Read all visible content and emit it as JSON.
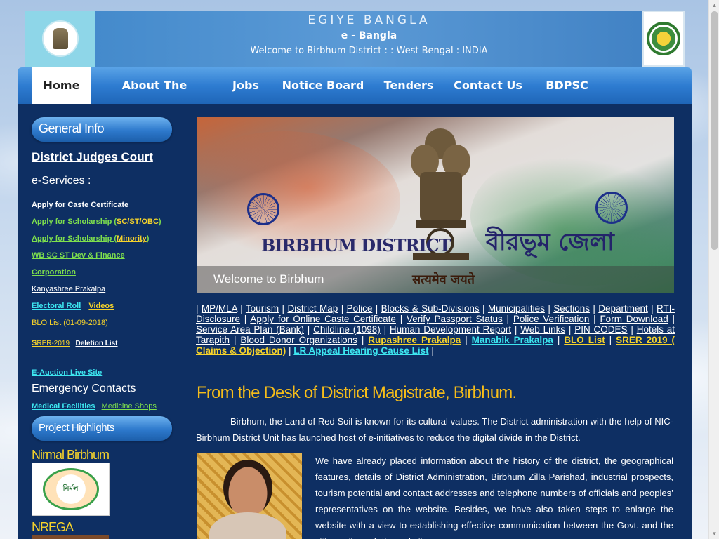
{
  "header": {
    "title": "EGIYE BANGLA",
    "subtitle": "e - Bangla",
    "welcome": "Welcome to Birbhum District : : West Bengal : INDIA"
  },
  "nav": [
    "Home",
    "About The District",
    "Jobs",
    "Notice Board",
    "Tenders",
    "Contact Us",
    "BDPSC"
  ],
  "sidebar": {
    "general_info": "General Info",
    "district_judges": "District Judges Court",
    "eservices": "e-Services :",
    "caste_cert": "Apply for Caste Certificate",
    "scholarship_sc_pre": "Apply for Scholarship (",
    "scholarship_sc_val": "SC/ST/OBC",
    "scholarship_sc_post": ")",
    "scholarship_min_pre": "Apply for Scholarship (",
    "scholarship_min_val": "Minority",
    "scholarship_min_post": ")",
    "wbsc_line1": "WB SC ST Dev & Finance",
    "wbsc_line2": "Corporation",
    "kanyashree": "Kanyashree Prakalpa",
    "electoral": "Electoral Roll",
    "videos": "Videos",
    "blo": "BLO List (01-09-2018)",
    "srer_s": "S",
    "srer_rest": "RER-2019",
    "deletion": "Deletion List",
    "eauction": "E-Auction Live Site",
    "emergency": "Emergency Contacts",
    "medical": "Medical Facilities",
    "medicine": "Medicine Shops",
    "project_highlights": "Project Highlights",
    "nirmal": "Nirmal Birbhum",
    "nirmal_logo_text": "নির্মল",
    "nrega": "NREGA"
  },
  "banner": {
    "title": "BIRBHUM DISTRICT",
    "bengali": "বীরভূম জেলা",
    "welcome": "Welcome to Birbhum",
    "motto": "सत्यमेव जयते"
  },
  "links": [
    {
      "t": "MP/MLA",
      "c": ""
    },
    {
      "t": "Tourism",
      "c": ""
    },
    {
      "t": "District Map",
      "c": ""
    },
    {
      "t": "Police",
      "c": ""
    },
    {
      "t": "Blocks & Sub-Divisions",
      "c": ""
    },
    {
      "t": "Municipalities",
      "c": ""
    },
    {
      "t": "Sections",
      "c": ""
    },
    {
      "t": "Department",
      "c": ""
    },
    {
      "t": "RTI-Disclosure",
      "c": ""
    },
    {
      "t": "Apply for Online Caste Certificate",
      "c": ""
    },
    {
      "t": "Verify Passport Status",
      "c": ""
    },
    {
      "t": "Police Verification",
      "c": ""
    },
    {
      "t": "Form Download",
      "c": ""
    },
    {
      "t": "Service Area Plan (Bank)",
      "c": ""
    },
    {
      "t": "Childline (1098)",
      "c": ""
    },
    {
      "t": "Human Development Report",
      "c": ""
    },
    {
      "t": "Web Links",
      "c": ""
    },
    {
      "t": "PIN CODES",
      "c": ""
    },
    {
      "t": "Hotels at Tarapith",
      "c": ""
    },
    {
      "t": "Blood Donor Organizations",
      "c": ""
    },
    {
      "t": "Rupashree Prakalpa",
      "c": "yl"
    },
    {
      "t": "Manabik Prakalpa",
      "c": "cy"
    },
    {
      "t": "BLO List",
      "c": "yl"
    },
    {
      "t": "SRER 2019 ( Claims & Objection)",
      "c": "yl"
    },
    {
      "t": "LR Appeal Hearing Cause List",
      "c": "cy"
    }
  ],
  "desk_heading": "From the Desk of District Magistrate, Birbhum.",
  "para1": "Birbhum, the Land of Red Soil is known for its cultural values. The District administration with the help of NIC-Birbhum District Unit has launched host of e-initiatives to reduce the digital divide in the District.",
  "para2": "We have already placed information about the history of the district, the geographical features, details of District Administration, Birbhum Zilla Parishad, industrial prospects, tourism potential and contact addresses and telephone numbers of officials and peoples’ representatives on the website. Besides, we have also taken steps to enlarge the website with a view to establishing effective communication between the Govt. and the citizens through the website."
}
